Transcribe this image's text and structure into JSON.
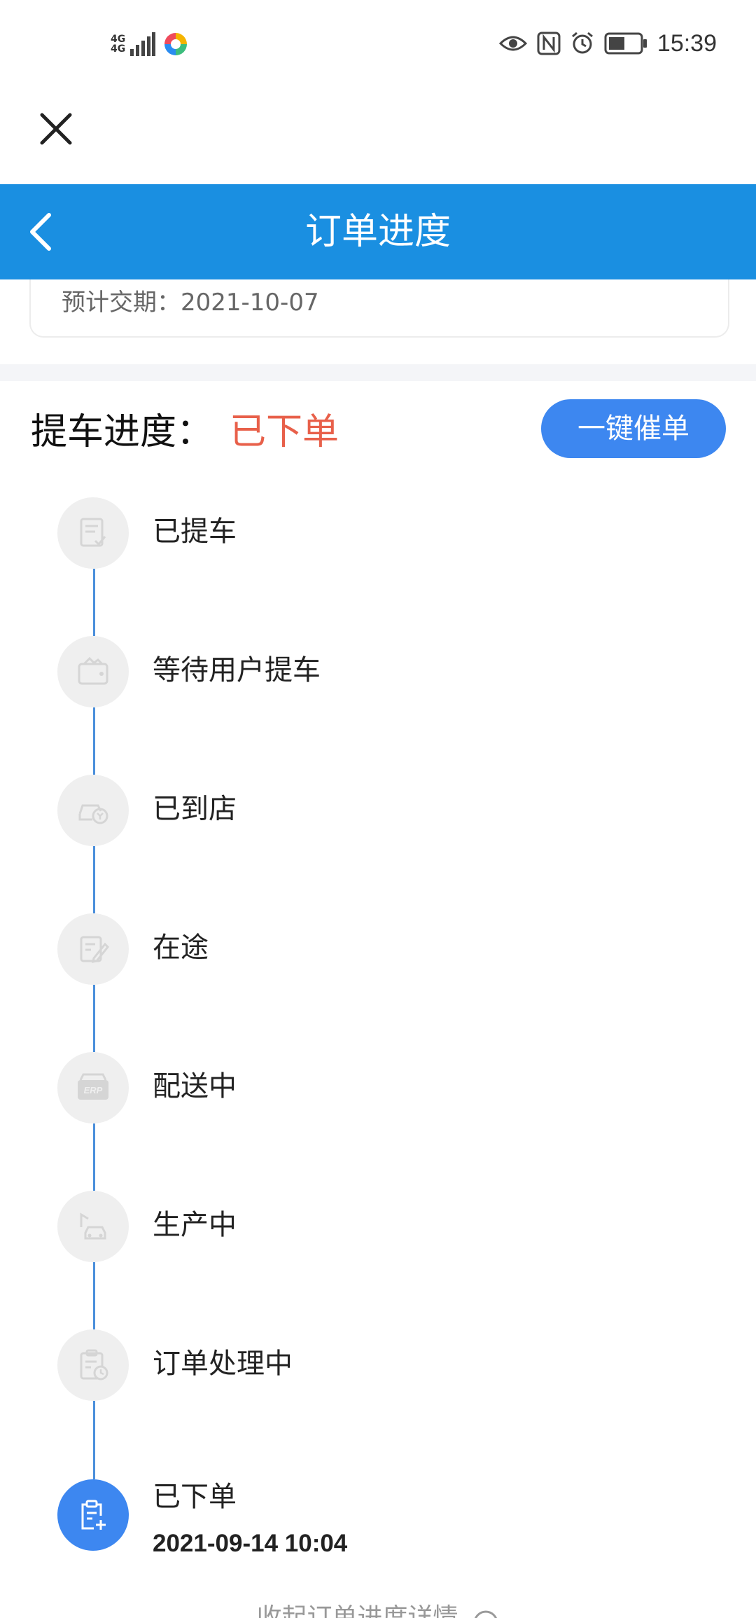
{
  "status_bar": {
    "network_top": "4G",
    "network_bottom": "4G",
    "time": "15:39"
  },
  "header": {
    "title": "订单进度"
  },
  "order_card": {
    "delivery_label": "预计交期：",
    "delivery_date": "2021-10-07"
  },
  "progress": {
    "label": "提车进度：",
    "current_status": "已下单",
    "urge_button": "一键催单"
  },
  "steps": [
    {
      "label": "已提车",
      "icon": "document-check-icon",
      "active": false
    },
    {
      "label": "等待用户提车",
      "icon": "wallet-icon",
      "active": false
    },
    {
      "label": "已到店",
      "icon": "car-store-icon",
      "active": false
    },
    {
      "label": "在途",
      "icon": "edit-note-icon",
      "active": false
    },
    {
      "label": "配送中",
      "icon": "erp-box-icon",
      "active": false
    },
    {
      "label": "生产中",
      "icon": "crane-car-icon",
      "active": false
    },
    {
      "label": "订单处理中",
      "icon": "clipboard-clock-icon",
      "active": false
    },
    {
      "label": "已下单",
      "icon": "clipboard-add-icon",
      "active": true,
      "time": "2021-09-14 10:04"
    }
  ],
  "footer": {
    "collapse_text": "收起订单进度详情"
  },
  "colors": {
    "header_blue": "#1a8fe1",
    "button_blue": "#3d87f0",
    "status_red": "#e8604a",
    "timeline_line": "#4b8fdb",
    "inactive_icon_bg": "#efefef"
  }
}
